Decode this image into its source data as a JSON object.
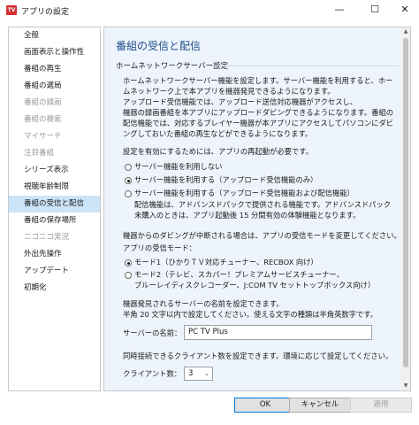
{
  "window": {
    "title": "アプリの設定",
    "icon_label": "TV",
    "controls": {
      "minimize": "—",
      "maximize": "☐",
      "close": "✕"
    }
  },
  "sidebar": {
    "items": [
      {
        "label": "全般",
        "state": "normal"
      },
      {
        "label": "画面表示と操作性",
        "state": "normal"
      },
      {
        "label": "番組の再生",
        "state": "normal"
      },
      {
        "label": "番組の選局",
        "state": "normal"
      },
      {
        "label": "番組の録画",
        "state": "disabled"
      },
      {
        "label": "番組の検索",
        "state": "disabled"
      },
      {
        "label": "マイサーチ",
        "state": "disabled"
      },
      {
        "label": "注目番組",
        "state": "disabled"
      },
      {
        "label": "シリーズ表示",
        "state": "normal"
      },
      {
        "label": "視聴年齢制限",
        "state": "normal"
      },
      {
        "label": "番組の受信と配信",
        "state": "selected"
      },
      {
        "label": "番組の保存場所",
        "state": "normal"
      },
      {
        "label": "ニコニコ実況",
        "state": "disabled"
      },
      {
        "label": "外出先操作",
        "state": "normal"
      },
      {
        "label": "アップデート",
        "state": "normal"
      },
      {
        "label": "初期化",
        "state": "normal"
      }
    ]
  },
  "content": {
    "section_title": "番組の受信と配信",
    "subheading": "ホームネットワークサーバー設定",
    "intro": [
      "ホームネットワークサーバー機能を設定します。サーバー機能を利用すると、ホー",
      "ムネットワーク上で本アプリを機器発見できるようになります。",
      "アップロード受信機能では、アップロード送信対応機器がアクセスし、",
      "機器の録画番組を本アプリにアップロードダビングできるようになります。番組の",
      "配信機能では、対応するプレイヤー機器が本アプリにアクセスしてパソコンにダビ",
      "ングしておいた番組の再生などができるようになります。"
    ],
    "restart_note": "設定を有効にするためには、アプリの再起動が必要です。",
    "server_options": [
      {
        "label": "サーバー機能を利用しない",
        "checked": false
      },
      {
        "label": "サーバー機能を利用する（アップロード受信機能のみ）",
        "checked": true
      },
      {
        "label": "サーバー機能を利用する（アップロード受信機能および配信機能）",
        "checked": false
      }
    ],
    "delivery_note": [
      "配信機能は、アドバンスドパックで提供される機能です。アドバンスドパック",
      "未購入のときは、アプリ起動後 15 分間有効の体験機能となります。"
    ],
    "dubbing_note": "機器からのダビングが中断される場合は、アプリの受信モードを変更してください。",
    "receive_mode_label": "アプリの受信モード：",
    "mode_options": [
      {
        "line1": "モード1（ひかりＴＶ対応チューナー、RECBOX 向け）",
        "line2": "",
        "checked": true
      },
      {
        "line1": "モード2（テレビ、スカパー！プレミアムサービスチューナー、",
        "line2": "ブルーレイディスクレコーダー、J:COM TV セットトップボックス向け）",
        "checked": false
      }
    ],
    "server_name_note": [
      "機器発見されるサーバーの名前を設定できます。",
      "半角 20 文字以内で設定してください。使える文字の種類は半角英数字です。"
    ],
    "server_name_label": "サーバーの名前：",
    "server_name_value": "PC TV Plus",
    "clients_note": "同時接続できるクライアント数を設定できます。環境に応じて設定してください。",
    "clients_label": "クライアント数：",
    "clients_value": "3"
  },
  "footer": {
    "ok": "OK",
    "cancel": "キャンセル",
    "apply": "適用"
  },
  "colors": {
    "title_accent": "#1f4e8c",
    "selected_item_bg": "#cce4f7",
    "content_bg": "#eef4fb",
    "app_icon": "#d32f2f"
  }
}
